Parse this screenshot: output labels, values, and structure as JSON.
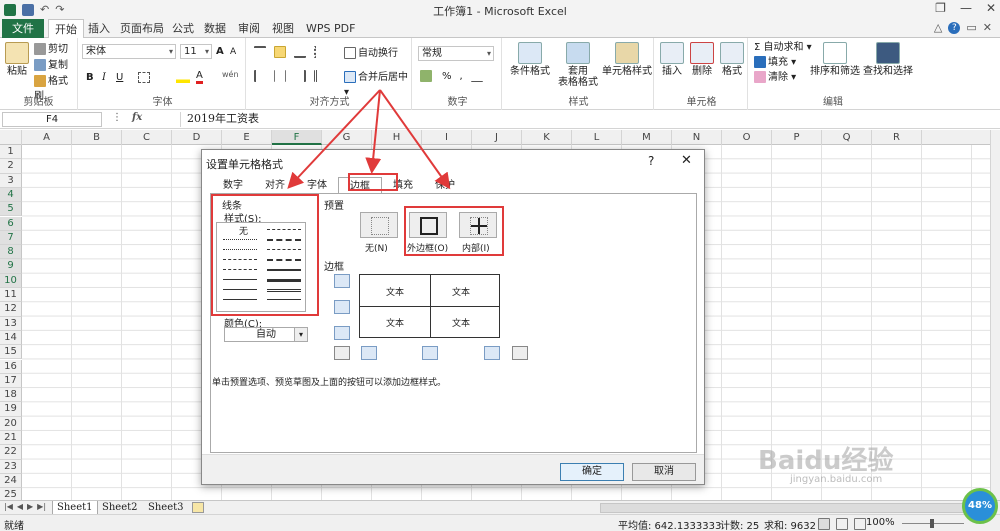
{
  "window": {
    "title": "工作簿1 - Microsoft Excel",
    "restore": "❐",
    "minimize": "—",
    "close": "✕"
  },
  "tabs": [
    {
      "label": "文件"
    },
    {
      "label": "开始"
    },
    {
      "label": "插入"
    },
    {
      "label": "页面布局"
    },
    {
      "label": "公式"
    },
    {
      "label": "数据"
    },
    {
      "label": "审阅"
    },
    {
      "label": "视图"
    },
    {
      "label": "WPS PDF"
    }
  ],
  "ribbon": {
    "clipboard": {
      "paste": "粘贴",
      "cut": "剪切",
      "copy": "复制",
      "format_painter": "格式刷",
      "group": "剪贴板"
    },
    "font": {
      "name": "宋体",
      "size": "11",
      "bold": "B",
      "italic": "I",
      "underline": "U",
      "grow": "A",
      "shrink": "A",
      "group": "字体",
      "wen": "wén"
    },
    "alignment": {
      "wrap": "自动换行",
      "merge": "合并后居中",
      "group": "对齐方式"
    },
    "number": {
      "format": "常规",
      "percent": "%",
      "comma": ",",
      "group": "数字"
    },
    "styles": {
      "conditional": "条件格式",
      "table1": "套用",
      "table2": "表格格式",
      "cell": "单元格样式",
      "group": "样式"
    },
    "cells": {
      "insert": "插入",
      "delete": "删除",
      "format": "格式",
      "group": "单元格"
    },
    "editing": {
      "autosum": "自动求和",
      "fill": "填充",
      "clear": "清除",
      "sort": "排序和筛选",
      "find": "查找和选择",
      "group": "编辑"
    }
  },
  "formula_bar": {
    "name_box": "F4",
    "fx": "fx",
    "content": "2019年工资表"
  },
  "grid": {
    "columns": [
      "A",
      "B",
      "C",
      "D",
      "E",
      "F",
      "G",
      "H",
      "I",
      "J",
      "K",
      "L",
      "M",
      "N",
      "O",
      "P",
      "Q",
      "R"
    ],
    "rows": [
      "1",
      "2",
      "3",
      "4",
      "5",
      "6",
      "7",
      "8",
      "9",
      "10",
      "11",
      "12",
      "13",
      "14",
      "15",
      "16",
      "17",
      "18",
      "19",
      "20",
      "21",
      "22",
      "23",
      "24",
      "25"
    ],
    "selected_column": "F",
    "selected_rows": [
      "4",
      "5",
      "6",
      "7",
      "8",
      "9",
      "10"
    ]
  },
  "sheets": [
    "Sheet1",
    "Sheet2",
    "Sheet3"
  ],
  "status": {
    "left": "就绪",
    "average": "平均值: 642.1333333",
    "count": "计数: 25",
    "sum": "求和: 9632",
    "zoom": "100%"
  },
  "dialog": {
    "title": "设置单元格格式",
    "help": "?",
    "close": "✕",
    "tabs": [
      "数字",
      "对齐",
      "字体",
      "边框",
      "填充",
      "保护"
    ],
    "active_tab": "边框",
    "line_label": "线条",
    "style_label": "样式(S):",
    "none_style": "无",
    "color_label": "颜色(C):",
    "color_value": "自动",
    "presets_label": "预置",
    "presets": [
      "无(N)",
      "外边框(O)",
      "内部(I)"
    ],
    "border_label": "边框",
    "preview_text": "文本",
    "hint": "单击预置选项、预览草图及上面的按钮可以添加边框样式。",
    "ok": "确定",
    "cancel": "取消"
  },
  "badge": {
    "value": "48%"
  },
  "watermark": {
    "text": "Baidu经验",
    "url": "jingyan.baidu.com"
  },
  "colors": {
    "excel_green": "#217346",
    "annotation_red": "#e03a3a",
    "dialog_border": "#888888"
  }
}
